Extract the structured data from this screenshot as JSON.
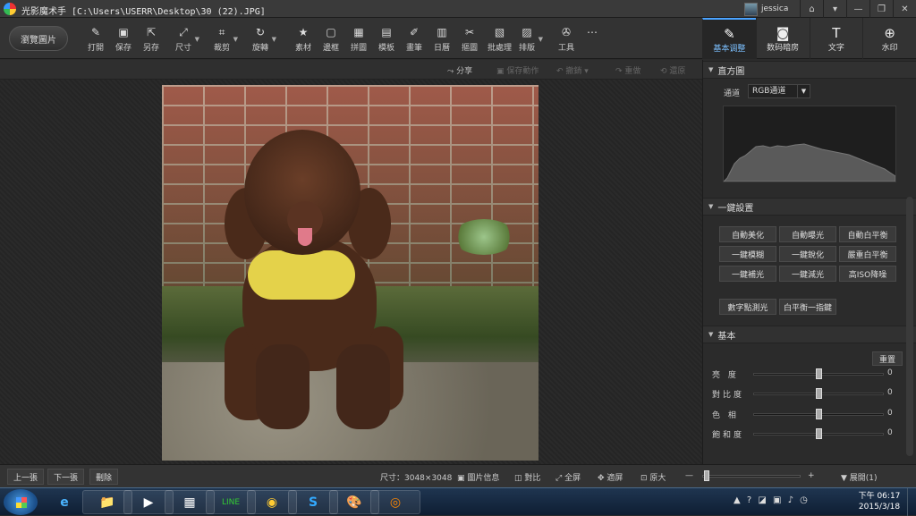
{
  "title": {
    "app_name": "光影魔术手",
    "file_path": "[C:\\Users\\USERR\\Desktop\\30 (22).JPG]",
    "user": "jessica"
  },
  "window_buttons": [
    "⌂",
    "▾",
    "—",
    "❐",
    "✕"
  ],
  "toolbar": {
    "open_label": "瀏覽圖片",
    "tools": [
      {
        "icon": "✎",
        "label": "打開"
      },
      {
        "icon": "▣",
        "label": "保存"
      },
      {
        "icon": "⇱",
        "label": "另存"
      },
      {
        "icon": "⤢",
        "label": "尺寸"
      },
      {
        "icon": "⌗",
        "label": "裁剪"
      },
      {
        "icon": "↻",
        "label": "旋轉"
      },
      {
        "icon": "★",
        "label": "素材"
      },
      {
        "icon": "▢",
        "label": "邊框"
      },
      {
        "icon": "▦",
        "label": "拼圖"
      },
      {
        "icon": "▤",
        "label": "模板"
      },
      {
        "icon": "✐",
        "label": "畫筆"
      },
      {
        "icon": "▥",
        "label": "日曆"
      },
      {
        "icon": "✂",
        "label": "摳圖"
      },
      {
        "icon": "▧",
        "label": "批處理"
      },
      {
        "icon": "▨",
        "label": "排版"
      },
      {
        "icon": "✇",
        "label": "工具"
      },
      {
        "icon": "⋯",
        "label": ""
      }
    ]
  },
  "right_tabs": [
    {
      "icon": "✎",
      "label": "基本调整"
    },
    {
      "icon": "◙",
      "label": "数码暗房"
    },
    {
      "icon": "T",
      "label": "文字"
    },
    {
      "icon": "⊕",
      "label": "水印"
    }
  ],
  "subbar": {
    "share": "分享",
    "save_action": "保存動作",
    "undo": "撤銷",
    "redo": "重做",
    "restore": "還原"
  },
  "histogram": {
    "title": "直方圖",
    "channel_label": "通道",
    "channel_value": "RGB通道"
  },
  "one_click": {
    "title": "一鍵設置",
    "buttons": [
      "自動美化",
      "自動曝光",
      "自動白平衡",
      "一鍵模糊",
      "一鍵銳化",
      "嚴重白平衡",
      "一鍵補光",
      "一鍵減光",
      "高ISO降噪"
    ],
    "extra_buttons": [
      "數字點測光",
      "白平衡一指鍵"
    ]
  },
  "basic": {
    "title": "基本",
    "reset_label": "重置",
    "sliders": [
      {
        "label": "亮 度",
        "value": 0
      },
      {
        "label": "對比度",
        "value": 0
      },
      {
        "label": "色 相",
        "value": 0
      },
      {
        "label": "飽和度",
        "value": 0
      }
    ]
  },
  "bottom": {
    "prev": "上一張",
    "next": "下一張",
    "delete": "刪除",
    "size_text": "尺寸：3048×3048",
    "info": "圖片信息",
    "compare": "對比",
    "fullscreen": "全屏",
    "fit": "適屏",
    "original": "原大",
    "zoom_minus": "—",
    "zoom_plus": "+",
    "expand": "展開(1)"
  },
  "taskbar": {
    "apps": [
      "📁",
      "▶",
      "▦",
      "LINE",
      "◉",
      "S",
      "🎨",
      "◎"
    ],
    "tray": "▲ ? ◪ ▣ ♪ ◷",
    "time": "下午 06:17",
    "date": "2015/3/18"
  }
}
